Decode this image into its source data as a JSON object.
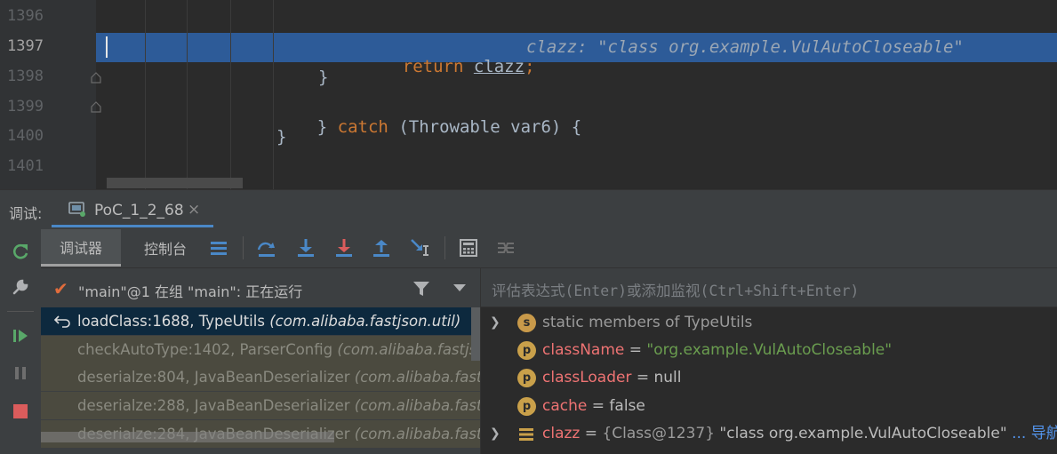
{
  "editor": {
    "lines": [
      {
        "number": "1396"
      },
      {
        "number": "1397"
      },
      {
        "number": "1398"
      },
      {
        "number": "1399"
      },
      {
        "number": "1400"
      },
      {
        "number": "1401"
      }
    ],
    "code": {
      "line1397_kw": "return",
      "line1397_var": "clazz",
      "line1397_semi": ";",
      "line1397_hint": "clazz: \"class org.example.VulAutoCloseable\"",
      "line1398": "}",
      "line1399_brace": "}",
      "line1399_kw": "catch",
      "line1399_rest": "(Throwable var6) {",
      "line1400": "}"
    }
  },
  "debug_window": {
    "title": "调试:",
    "tab_label": "PoC_1_2_68",
    "tab_close": "×"
  },
  "toolbar": {
    "debugger_tab": "调试器",
    "console_tab": "控制台"
  },
  "thread": {
    "label": "\"main\"@1 在组 \"main\": 正在运行"
  },
  "frames": [
    {
      "method": "loadClass:1688, TypeUtils",
      "pkg": "(com.alibaba.fastjson.util)"
    },
    {
      "method": "checkAutoType:1402, ParserConfig",
      "pkg": "(com.alibaba.fastjson.parser)"
    },
    {
      "method": "deserialze:804, JavaBeanDeserializer",
      "pkg": "(com.alibaba.fastjson.parser.deserializer)"
    },
    {
      "method": "deserialze:288, JavaBeanDeserializer",
      "pkg": "(com.alibaba.fastjson.parser.deserializer)"
    },
    {
      "method": "deserialze:284, JavaBeanDeserializer",
      "pkg": "(com.alibaba.fastjson.parser.deserializer)"
    }
  ],
  "watch": {
    "placeholder": "评估表达式(Enter)或添加监视(Ctrl+Shift+Enter)"
  },
  "variables": [
    {
      "badge": "s",
      "text": "static members of TypeUtils"
    },
    {
      "badge": "p",
      "name": "className",
      "eq": " = ",
      "value": "\"org.example.VulAutoCloseable\""
    },
    {
      "badge": "p",
      "name": "classLoader",
      "eq": " = ",
      "value": "null"
    },
    {
      "badge": "p",
      "name": "cache",
      "eq": " = ",
      "value": "false"
    },
    {
      "name": "clazz",
      "eq": " = ",
      "ref": "{Class@1237}",
      "value": " \"class org.example.VulAutoCloseable\"",
      "more": " ...",
      "link": " 导航"
    }
  ],
  "colors": {
    "highlight_line": "#2d5b98",
    "keyword": "#cc7832",
    "string_value": "#6a9d4f",
    "field_name": "#ee7373",
    "link": "#5394ec"
  }
}
